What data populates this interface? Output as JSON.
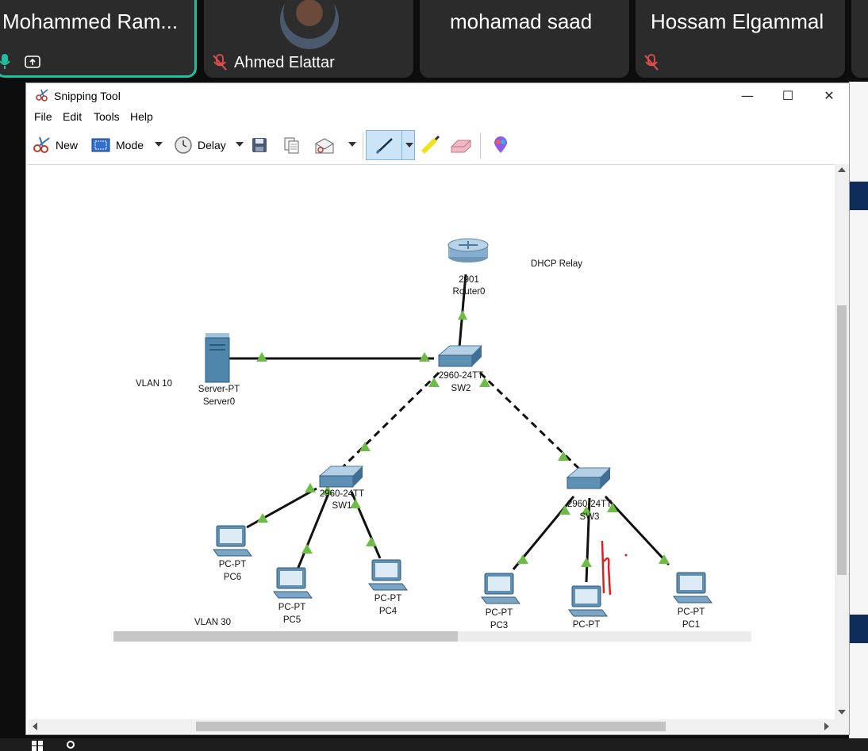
{
  "meeting": {
    "participants": [
      {
        "name": "Mohammed Ram...",
        "active": true
      },
      {
        "name": "Ahmed Elattar",
        "muted": true
      },
      {
        "name": "mohamad saad"
      },
      {
        "name": "Hossam Elgammal",
        "muted": true
      }
    ],
    "accent_color": "#1fbf9f"
  },
  "snipping_tool": {
    "title": "Snipping Tool",
    "menu": [
      "File",
      "Edit",
      "Tools",
      "Help"
    ],
    "toolbar": {
      "new": "New",
      "mode": "Mode",
      "delay": "Delay"
    },
    "window_buttons": {
      "minimize": "—",
      "maximize": "☐",
      "close": "✕"
    }
  },
  "topology": {
    "notes": {
      "dhcp": "DHCP Relay",
      "vlan10": "VLAN 10",
      "vlan30": "VLAN 30"
    },
    "router": {
      "model": "2901",
      "name": "Router0"
    },
    "server": {
      "model": "Server-PT",
      "name": "Server0"
    },
    "sw2": {
      "model": "2960-24TT",
      "name": "SW2"
    },
    "sw1": {
      "model": "2960-24TT",
      "name": "SW1"
    },
    "sw3": {
      "model": "2960-24TT",
      "name": "SW3"
    },
    "pcs": [
      {
        "model": "PC-PT",
        "name": "PC6"
      },
      {
        "model": "PC-PT",
        "name": "PC5"
      },
      {
        "model": "PC-PT",
        "name": "PC4"
      },
      {
        "model": "PC-PT",
        "name": "PC3"
      },
      {
        "model": "PC-PT",
        "name": ""
      },
      {
        "model": "PC-PT",
        "name": "PC1"
      }
    ],
    "link_up_color": "#6dbd45"
  }
}
